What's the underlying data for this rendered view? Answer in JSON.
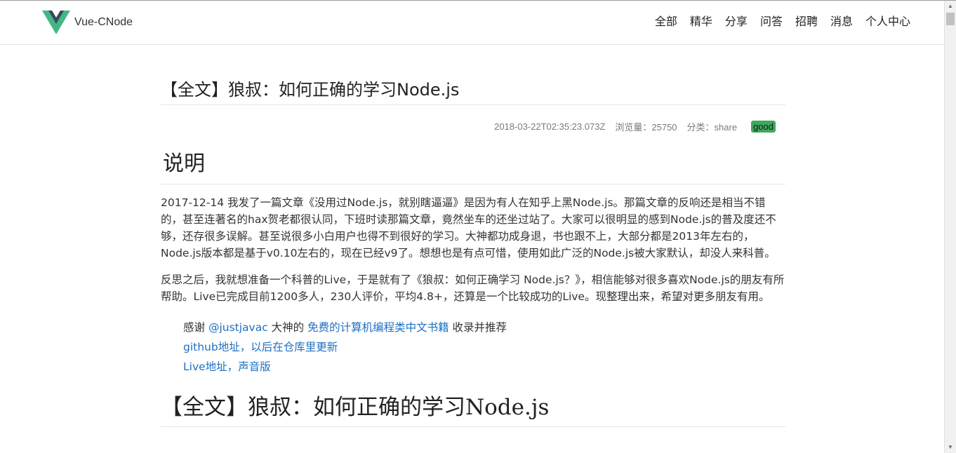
{
  "header": {
    "brand": "Vue-CNode",
    "nav": [
      "全部",
      "精华",
      "分享",
      "问答",
      "招聘",
      "消息",
      "个人中心"
    ]
  },
  "article": {
    "title": "【全文】狼叔：如何正确的学习Node.js",
    "meta": {
      "date": "2018-03-22T02:35:23.073Z",
      "views": "浏览量：25750",
      "category": "分类：share",
      "badge": "good"
    },
    "section_heading": "说明",
    "paragraph1": "2017-12-14 我发了一篇文章《没用过Node.js，就别瞎逼逼》是因为有人在知乎上黑Node.js。那篇文章的反响还是相当不错的，甚至连著名的hax贺老都很认同，下班时读那篇文章，竟然坐车的还坐过站了。大家可以很明显的感到Node.js的普及度还不够，还存很多误解。甚至说很多小白用户也得不到很好的学习。大神都功成身退，书也跟不上，大部分都是2013年左右的，Node.js版本都是基于v0.10左右的，现在已经v9了。想想也是有点可惜，使用如此广泛的Node.js被大家默认，却没人来科普。",
    "paragraph2": "反思之后，我就想准备一个科普的Live，于是就有了《狼叔：如何正确学习 Node.js？》，相信能够对很多喜欢Node.js的朋友有所帮助。Live已完成目前1200多人，230人评价，平均4.8+，还算是一个比较成功的Live。现整理出来，希望对更多朋友有用。",
    "thanks": {
      "prefix": "感谢 ",
      "user_link": "@justjavac",
      "middle": " 大神的 ",
      "book_link": "免费的计算机编程类中文书籍",
      "suffix": " 收录并推荐"
    },
    "github_link": "github地址，以后在仓库里更新",
    "live_link": "Live地址，声音版",
    "second_heading": "【全文】狼叔：如何正确的学习Node.js"
  },
  "colors": {
    "logo_green": "#41b883",
    "logo_dark": "#35495e",
    "badge_green": "#3ea95e",
    "link_blue": "#1e6fc2"
  }
}
